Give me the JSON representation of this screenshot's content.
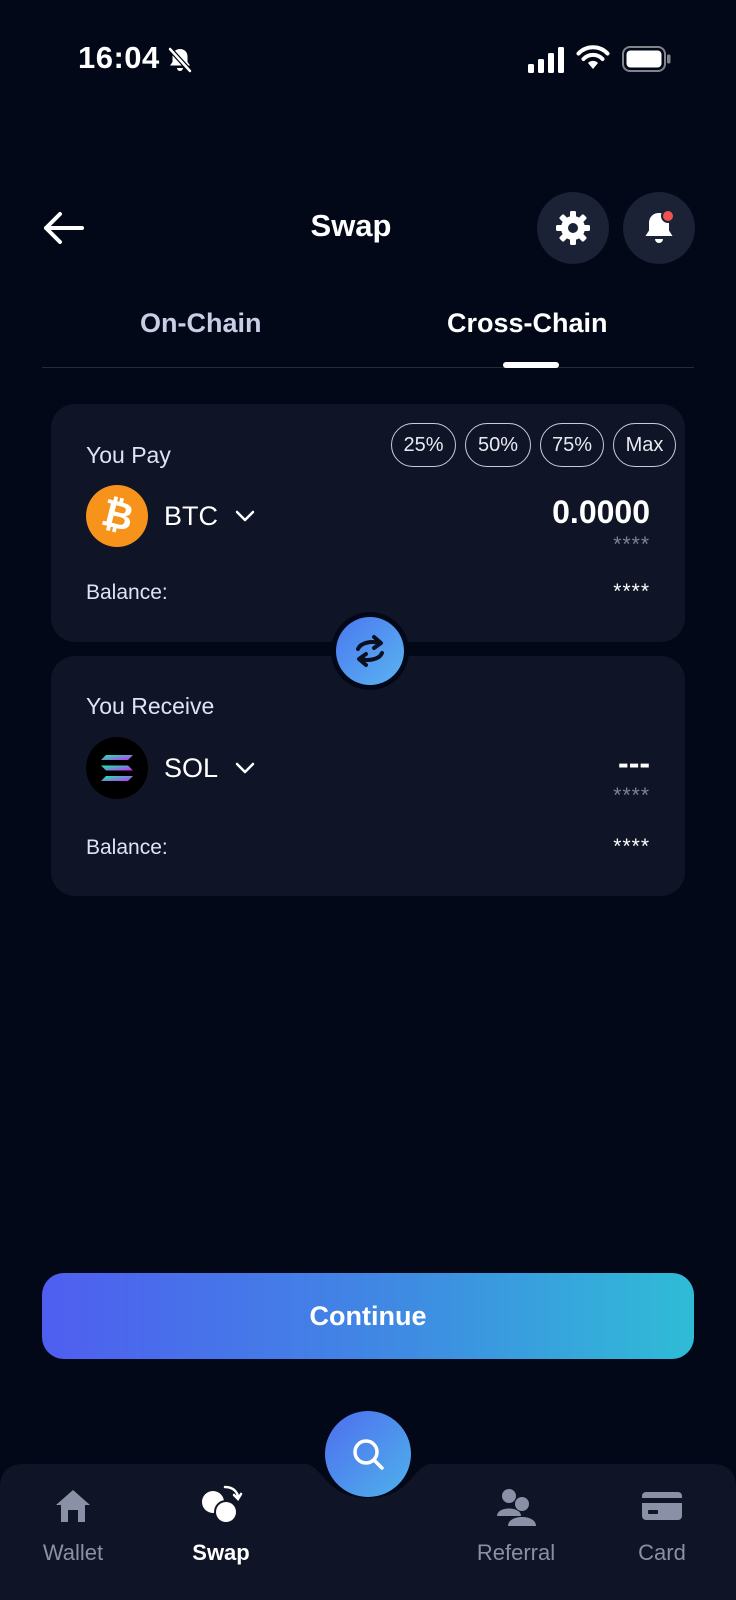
{
  "status_bar": {
    "time": "16:04",
    "icons": [
      "bell-slash-icon",
      "signal-icon",
      "wifi-icon",
      "battery-icon"
    ]
  },
  "header": {
    "title": "Swap",
    "back_icon": "arrow-left-icon",
    "settings_icon": "gear-icon",
    "notifications_icon": "bell-icon",
    "notification_dot_color": "#f0524f"
  },
  "tabs": [
    {
      "label": "On-Chain",
      "active": false
    },
    {
      "label": "Cross-Chain",
      "active": true
    }
  ],
  "pay_card": {
    "label": "You Pay",
    "percent_buttons": [
      "25%",
      "50%",
      "75%",
      "Max"
    ],
    "token": {
      "symbol": "BTC",
      "icon": "bitcoin-icon",
      "color": "#f7931a"
    },
    "amount": "0.0000",
    "amount_fiat": "****",
    "balance_label": "Balance:",
    "balance_value": "****"
  },
  "receive_card": {
    "label": "You Receive",
    "token": {
      "symbol": "SOL",
      "icon": "solana-icon",
      "color": "#000000"
    },
    "amount": "---",
    "amount_fiat": "****",
    "balance_label": "Balance:",
    "balance_value": "****"
  },
  "swap_direction_icon": "swap-arrows-icon",
  "continue_label": "Continue",
  "bottom_nav": {
    "items": [
      {
        "label": "Wallet",
        "icon": "home-icon",
        "active": false
      },
      {
        "label": "Swap",
        "icon": "swap-coins-icon",
        "active": true
      },
      {
        "label": "Referral",
        "icon": "users-icon",
        "active": false
      },
      {
        "label": "Card",
        "icon": "credit-card-icon",
        "active": false
      }
    ],
    "fab_icon": "search-icon"
  },
  "colors": {
    "background": "#020817",
    "card": "#0f1526",
    "accent_start": "#4f5ef0",
    "accent_end": "#2fbcd6"
  }
}
